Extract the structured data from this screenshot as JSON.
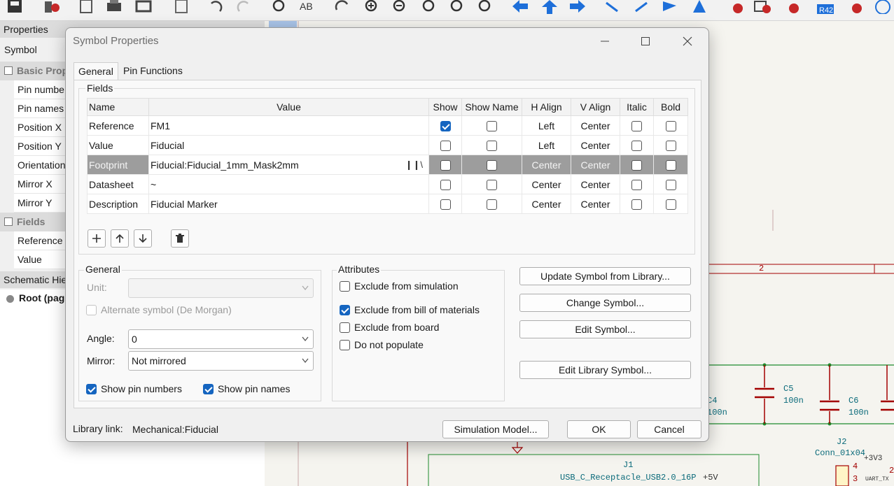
{
  "left_panel": {
    "properties_title": "Properties",
    "close_glyph": "×",
    "symbol_label": "Symbol",
    "group_basic": "Basic Prop",
    "basic_rows": [
      "Pin numbe",
      "Pin names",
      "Position X",
      "Position Y",
      "Orientation",
      "Mirror X",
      "Mirror Y"
    ],
    "group_fields": "Fields",
    "field_rows": [
      "Reference",
      "Value"
    ],
    "hierarchy_title": "Schematic Hie",
    "tree_root": "Root (pag"
  },
  "canvas": {
    "sheet_number": "2",
    "c4_label": "C4",
    "c4_value": "100n",
    "c5_label": "C5",
    "c5_value": "100n",
    "c6_label": "C6",
    "c6_value": "100n",
    "j2_label": "J2",
    "j2_value": "Conn_01x04",
    "pin4": "4",
    "pin3": "3",
    "pin2": "2",
    "power_3v3": "+3V3",
    "uart_label": "UART_TX",
    "j1_label": "J1",
    "j1_value": "USB_C_Receptacle_USB2.0_16P",
    "power_5v": "+5V"
  },
  "dialog": {
    "title": "Symbol Properties",
    "tabs": [
      "General",
      "Pin Functions"
    ],
    "fields_group": "Fields",
    "columns": [
      "Name",
      "Value",
      "Show",
      "Show Name",
      "H Align",
      "V Align",
      "Italic",
      "Bold"
    ],
    "rows": [
      {
        "name": "Reference",
        "value": "FM1",
        "show": true,
        "show_name": false,
        "h_align": "Left",
        "v_align": "Center",
        "italic": false,
        "bold": false
      },
      {
        "name": "Value",
        "value": "Fiducial",
        "show": false,
        "show_name": false,
        "h_align": "Left",
        "v_align": "Center",
        "italic": false,
        "bold": false
      },
      {
        "name": "Footprint",
        "value": "Fiducial:Fiducial_1mm_Mask2mm",
        "show": false,
        "show_name": false,
        "h_align": "Center",
        "v_align": "Center",
        "italic": false,
        "bold": false,
        "selected": true
      },
      {
        "name": "Datasheet",
        "value": "~",
        "show": false,
        "show_name": false,
        "h_align": "Center",
        "v_align": "Center",
        "italic": false,
        "bold": false
      },
      {
        "name": "Description",
        "value": "Fiducial Marker",
        "show": false,
        "show_name": false,
        "h_align": "Center",
        "v_align": "Center",
        "italic": false,
        "bold": false
      }
    ],
    "general_group": "General",
    "unit_label": "Unit:",
    "unit_value": "",
    "alternate_label": "Alternate symbol (De Morgan)",
    "angle_label": "Angle:",
    "angle_value": "0",
    "mirror_label": "Mirror:",
    "mirror_value": "Not mirrored",
    "show_pin_numbers": "Show pin numbers",
    "show_pin_names": "Show pin names",
    "attributes_group": "Attributes",
    "exclude_sim": "Exclude from simulation",
    "exclude_bom": "Exclude from bill of materials",
    "exclude_board": "Exclude from board",
    "do_not_populate": "Do not populate",
    "btn_update": "Update Symbol from Library...",
    "btn_change": "Change Symbol...",
    "btn_edit": "Edit Symbol...",
    "btn_edit_lib": "Edit Library Symbol...",
    "library_link_label": "Library link:",
    "library_link_value": "Mechanical:Fiducial",
    "btn_sim": "Simulation Model...",
    "btn_ok": "OK",
    "btn_cancel": "Cancel"
  },
  "colors": {
    "accent": "#1565c0",
    "selected_row": "#9d9d9d",
    "wire": "#1f8a2d",
    "sheet_border": "#a30000"
  }
}
